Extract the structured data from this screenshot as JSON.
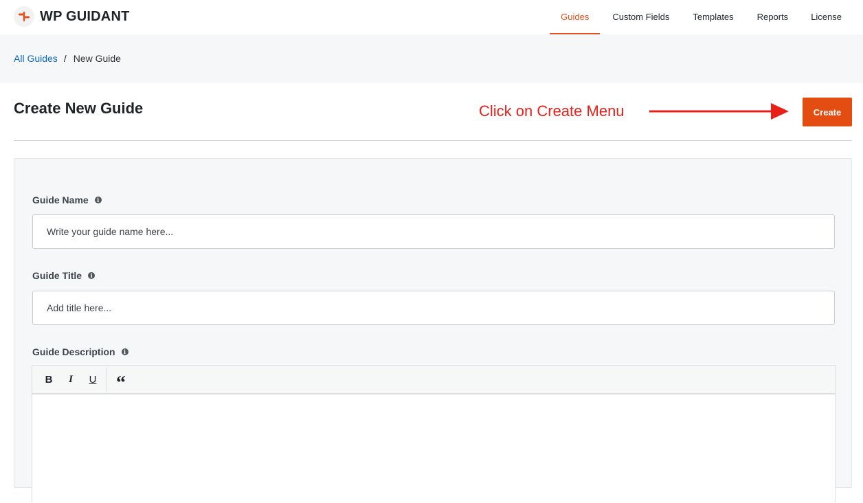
{
  "app": {
    "brand_name": "WP GUIDANT",
    "brand_color": "#e2501b"
  },
  "nav": {
    "items": [
      {
        "label": "Guides",
        "active": true
      },
      {
        "label": "Custom Fields",
        "active": false
      },
      {
        "label": "Templates",
        "active": false
      },
      {
        "label": "Reports",
        "active": false
      },
      {
        "label": "License",
        "active": false
      }
    ]
  },
  "breadcrumb": {
    "parent": "All Guides",
    "separator": "/",
    "current": "New Guide"
  },
  "header": {
    "title": "Create New Guide",
    "create_label": "Create",
    "annotation_text": "Click on Create Menu",
    "annotation_color": "#e8201a"
  },
  "form": {
    "guide_name": {
      "label": "Guide Name",
      "placeholder": "Write your guide name here...",
      "value": ""
    },
    "guide_title": {
      "label": "Guide Title",
      "placeholder": "Add title here...",
      "value": ""
    },
    "guide_description": {
      "label": "Guide Description",
      "toolbar": [
        {
          "icon": "bold-icon",
          "glyph": "B"
        },
        {
          "icon": "italic-icon",
          "glyph": "I"
        },
        {
          "icon": "underline-icon",
          "glyph": "U"
        },
        {
          "icon": "blockquote-icon",
          "glyph": "“"
        }
      ]
    },
    "info_glyph": "i"
  }
}
